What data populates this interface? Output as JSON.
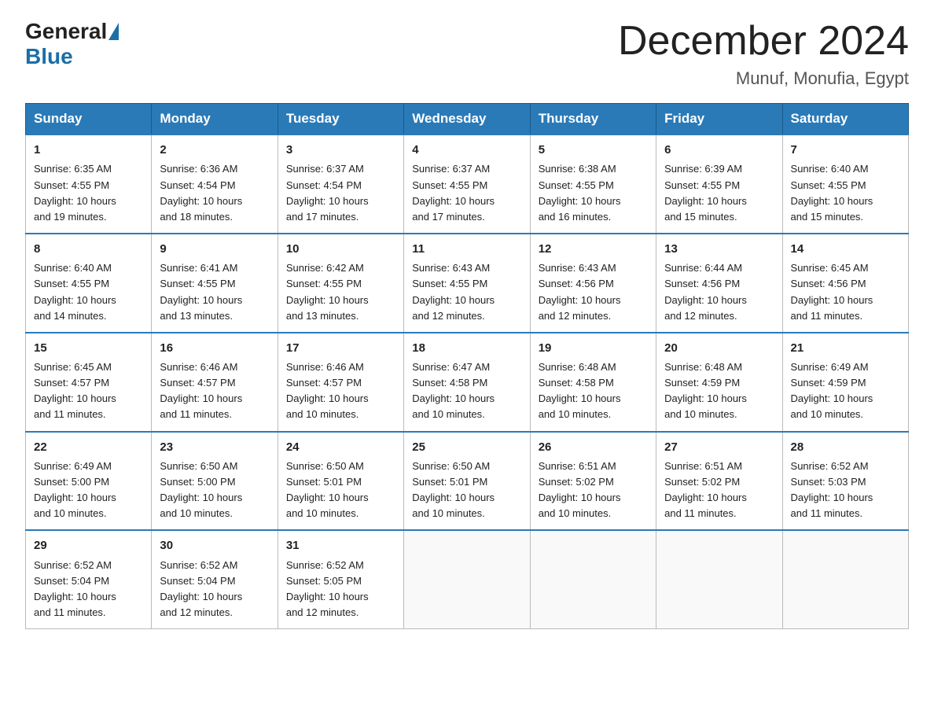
{
  "header": {
    "logo_general": "General",
    "logo_blue": "Blue",
    "month_title": "December 2024",
    "location": "Munuf, Monufia, Egypt"
  },
  "days_of_week": [
    "Sunday",
    "Monday",
    "Tuesday",
    "Wednesday",
    "Thursday",
    "Friday",
    "Saturday"
  ],
  "weeks": [
    [
      {
        "day": "1",
        "sunrise": "6:35 AM",
        "sunset": "4:55 PM",
        "daylight": "10 hours and 19 minutes."
      },
      {
        "day": "2",
        "sunrise": "6:36 AM",
        "sunset": "4:54 PM",
        "daylight": "10 hours and 18 minutes."
      },
      {
        "day": "3",
        "sunrise": "6:37 AM",
        "sunset": "4:54 PM",
        "daylight": "10 hours and 17 minutes."
      },
      {
        "day": "4",
        "sunrise": "6:37 AM",
        "sunset": "4:55 PM",
        "daylight": "10 hours and 17 minutes."
      },
      {
        "day": "5",
        "sunrise": "6:38 AM",
        "sunset": "4:55 PM",
        "daylight": "10 hours and 16 minutes."
      },
      {
        "day": "6",
        "sunrise": "6:39 AM",
        "sunset": "4:55 PM",
        "daylight": "10 hours and 15 minutes."
      },
      {
        "day": "7",
        "sunrise": "6:40 AM",
        "sunset": "4:55 PM",
        "daylight": "10 hours and 15 minutes."
      }
    ],
    [
      {
        "day": "8",
        "sunrise": "6:40 AM",
        "sunset": "4:55 PM",
        "daylight": "10 hours and 14 minutes."
      },
      {
        "day": "9",
        "sunrise": "6:41 AM",
        "sunset": "4:55 PM",
        "daylight": "10 hours and 13 minutes."
      },
      {
        "day": "10",
        "sunrise": "6:42 AM",
        "sunset": "4:55 PM",
        "daylight": "10 hours and 13 minutes."
      },
      {
        "day": "11",
        "sunrise": "6:43 AM",
        "sunset": "4:55 PM",
        "daylight": "10 hours and 12 minutes."
      },
      {
        "day": "12",
        "sunrise": "6:43 AM",
        "sunset": "4:56 PM",
        "daylight": "10 hours and 12 minutes."
      },
      {
        "day": "13",
        "sunrise": "6:44 AM",
        "sunset": "4:56 PM",
        "daylight": "10 hours and 12 minutes."
      },
      {
        "day": "14",
        "sunrise": "6:45 AM",
        "sunset": "4:56 PM",
        "daylight": "10 hours and 11 minutes."
      }
    ],
    [
      {
        "day": "15",
        "sunrise": "6:45 AM",
        "sunset": "4:57 PM",
        "daylight": "10 hours and 11 minutes."
      },
      {
        "day": "16",
        "sunrise": "6:46 AM",
        "sunset": "4:57 PM",
        "daylight": "10 hours and 11 minutes."
      },
      {
        "day": "17",
        "sunrise": "6:46 AM",
        "sunset": "4:57 PM",
        "daylight": "10 hours and 10 minutes."
      },
      {
        "day": "18",
        "sunrise": "6:47 AM",
        "sunset": "4:58 PM",
        "daylight": "10 hours and 10 minutes."
      },
      {
        "day": "19",
        "sunrise": "6:48 AM",
        "sunset": "4:58 PM",
        "daylight": "10 hours and 10 minutes."
      },
      {
        "day": "20",
        "sunrise": "6:48 AM",
        "sunset": "4:59 PM",
        "daylight": "10 hours and 10 minutes."
      },
      {
        "day": "21",
        "sunrise": "6:49 AM",
        "sunset": "4:59 PM",
        "daylight": "10 hours and 10 minutes."
      }
    ],
    [
      {
        "day": "22",
        "sunrise": "6:49 AM",
        "sunset": "5:00 PM",
        "daylight": "10 hours and 10 minutes."
      },
      {
        "day": "23",
        "sunrise": "6:50 AM",
        "sunset": "5:00 PM",
        "daylight": "10 hours and 10 minutes."
      },
      {
        "day": "24",
        "sunrise": "6:50 AM",
        "sunset": "5:01 PM",
        "daylight": "10 hours and 10 minutes."
      },
      {
        "day": "25",
        "sunrise": "6:50 AM",
        "sunset": "5:01 PM",
        "daylight": "10 hours and 10 minutes."
      },
      {
        "day": "26",
        "sunrise": "6:51 AM",
        "sunset": "5:02 PM",
        "daylight": "10 hours and 10 minutes."
      },
      {
        "day": "27",
        "sunrise": "6:51 AM",
        "sunset": "5:02 PM",
        "daylight": "10 hours and 11 minutes."
      },
      {
        "day": "28",
        "sunrise": "6:52 AM",
        "sunset": "5:03 PM",
        "daylight": "10 hours and 11 minutes."
      }
    ],
    [
      {
        "day": "29",
        "sunrise": "6:52 AM",
        "sunset": "5:04 PM",
        "daylight": "10 hours and 11 minutes."
      },
      {
        "day": "30",
        "sunrise": "6:52 AM",
        "sunset": "5:04 PM",
        "daylight": "10 hours and 12 minutes."
      },
      {
        "day": "31",
        "sunrise": "6:52 AM",
        "sunset": "5:05 PM",
        "daylight": "10 hours and 12 minutes."
      },
      null,
      null,
      null,
      null
    ]
  ],
  "labels": {
    "sunrise": "Sunrise:",
    "sunset": "Sunset:",
    "daylight": "Daylight:"
  }
}
